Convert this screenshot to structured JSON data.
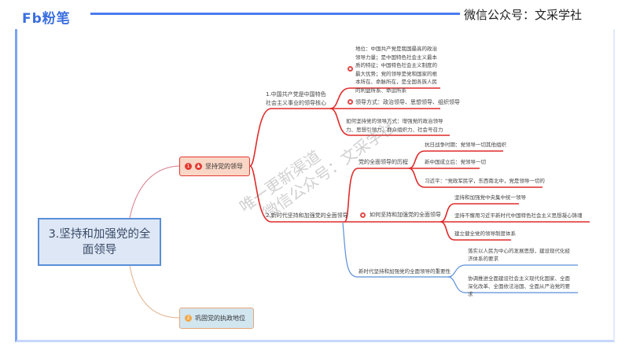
{
  "header": {
    "logo": "Fb粉笔",
    "wechat": "微信公众号：文采学社"
  },
  "watermark": [
    "唯一更新渠道",
    "微信公众号：文采学社"
  ],
  "central": "3.坚持和加强党的全面领导",
  "node1": {
    "num": "1",
    "label": "坚持党的领导"
  },
  "node2": {
    "num": "2",
    "label": "巩固党的执政地位"
  },
  "b1": {
    "title": "1.中国共产党是中国特色社会主义事业的领导核心",
    "items": [
      "地位：中国共产党是我国最高的政治领导力量；是中国特色社会主义最本质的特征；中国特色社会主义制度的最大优势；党的领导是党和国家的根本所在、命脉所在，是全国各族人民的利益所系、命运所系",
      "领导方式：政治领导、思想领导、组织领导",
      "如何坚持党的领导方式：增强党的政治领导力、思想引领力、群众组织力、社会号召力"
    ]
  },
  "b2": {
    "title": "2.新时代坚持和加强党的全面领导",
    "history": {
      "title": "党的全面领导的历程",
      "items": [
        "抗日战争时期：党领导一切其他组织",
        "新中国成立后：党领导一切",
        "习近平：“党政军民学，东西南北中，党是领导一切的"
      ]
    },
    "how": {
      "title": "如何坚持和加强党的全面领导",
      "items": [
        "坚持和加强党中央集中统一领导",
        "坚持不懈用习近平新时代中国特色社会主义思想凝心铸魂",
        "建立健全党的领导制度体系"
      ]
    },
    "importance": {
      "title": "新时代坚持和加强党的全面领导的重要性",
      "items": [
        "落实以人民为中心的发展思想，建设现代化经济体系的要求",
        "协调推进全面建设社会主义现代化国家、全面深化改革、全面依法治国、全面从严治党的要求"
      ]
    }
  }
}
